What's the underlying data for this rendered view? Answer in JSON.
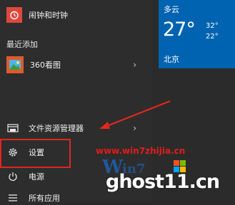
{
  "start_menu": {
    "top_app_label": "闹钟和时钟",
    "recent_section_title": "最近添加",
    "recent_app_label": "360看图",
    "file_explorer_label": "文件资源管理器",
    "settings_label": "设置",
    "power_label": "电源",
    "all_apps_label": "所有应用"
  },
  "weather_tile": {
    "condition": "多云",
    "temperature": "27°",
    "high": "32°",
    "low": "22°",
    "city": "北京"
  },
  "watermark": {
    "url": "www.win7zhijia.cn",
    "site": "ghost11.cn"
  },
  "colors": {
    "menu_bg": "#2d2d2d",
    "tile_blue": "#0063b1",
    "highlight_red": "#e2261f",
    "alarm_tile": "#e0473c",
    "photo_tile": "#e15a2a"
  }
}
